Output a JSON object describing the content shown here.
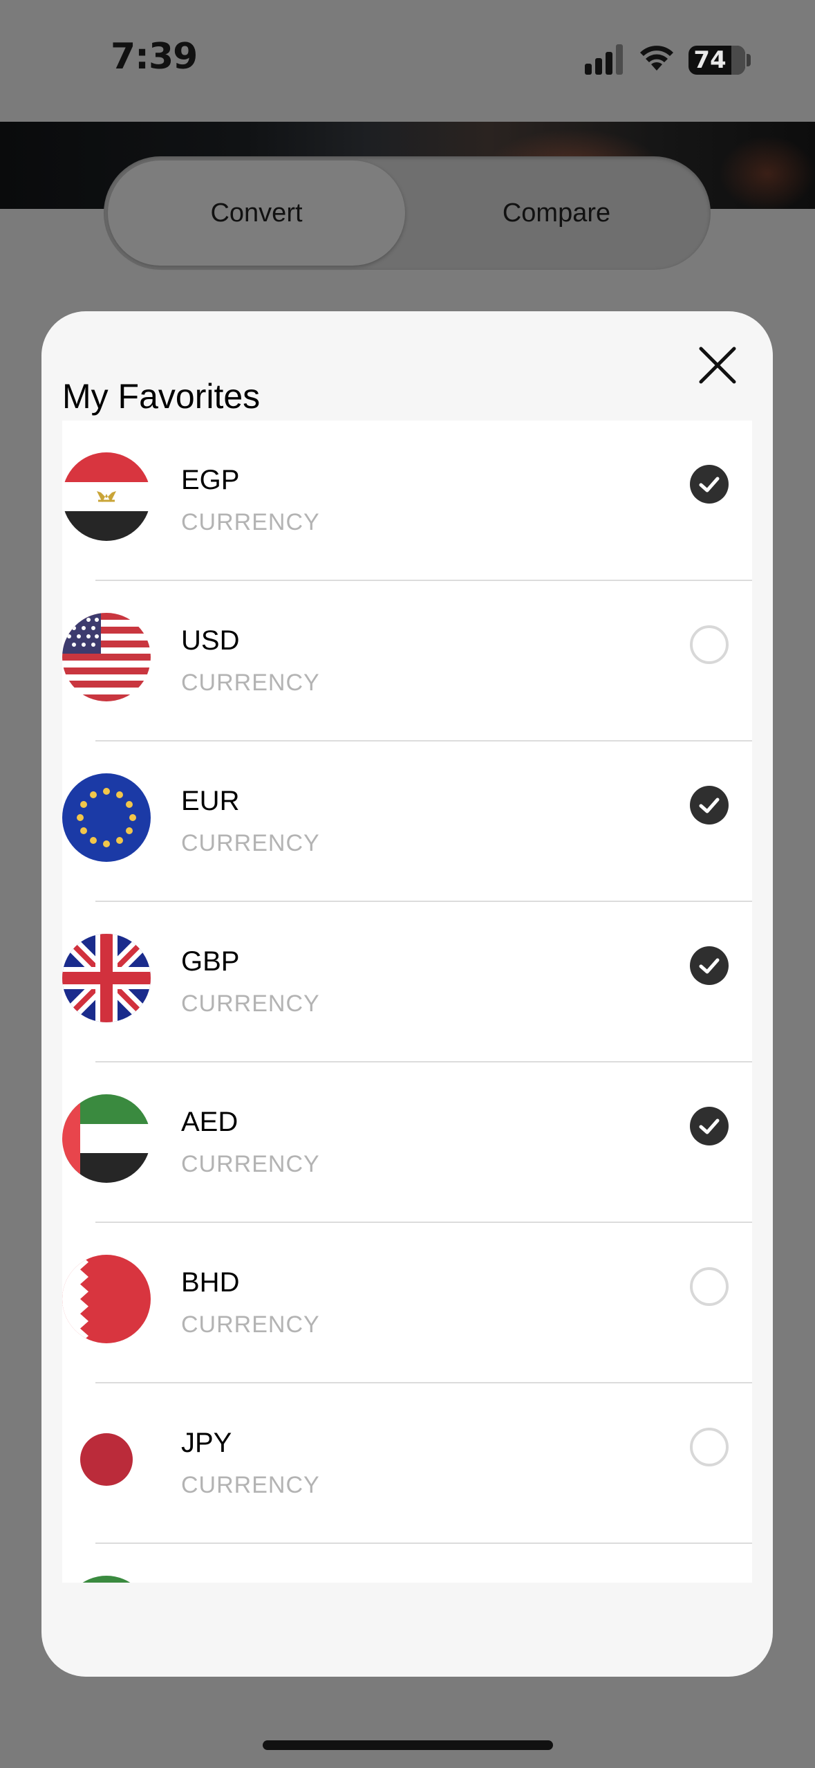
{
  "status_bar": {
    "time": "7:39",
    "battery": "74"
  },
  "tabs": [
    {
      "label": "Convert",
      "active": true
    },
    {
      "label": "Compare",
      "active": false
    }
  ],
  "modal": {
    "title": "My Favorites",
    "close_icon": "close-icon",
    "currencies": [
      {
        "code": "EGP",
        "subtitle": "CURRENCY",
        "flag": "egypt-flag-icon",
        "selected": true
      },
      {
        "code": "USD",
        "subtitle": "CURRENCY",
        "flag": "usa-flag-icon",
        "selected": false
      },
      {
        "code": "EUR",
        "subtitle": "CURRENCY",
        "flag": "eu-flag-icon",
        "selected": true
      },
      {
        "code": "GBP",
        "subtitle": "CURRENCY",
        "flag": "uk-flag-icon",
        "selected": true
      },
      {
        "code": "AED",
        "subtitle": "CURRENCY",
        "flag": "uae-flag-icon",
        "selected": true
      },
      {
        "code": "BHD",
        "subtitle": "CURRENCY",
        "flag": "bahrain-flag-icon",
        "selected": false
      },
      {
        "code": "JPY",
        "subtitle": "CURRENCY",
        "flag": "japan-flag-icon",
        "selected": false
      }
    ]
  },
  "colors": {
    "overlay": "#7b7b7b",
    "modal_bg": "#f6f6f6",
    "check_on": "#2f2f2f",
    "subtitle": "#b3b3b3"
  }
}
